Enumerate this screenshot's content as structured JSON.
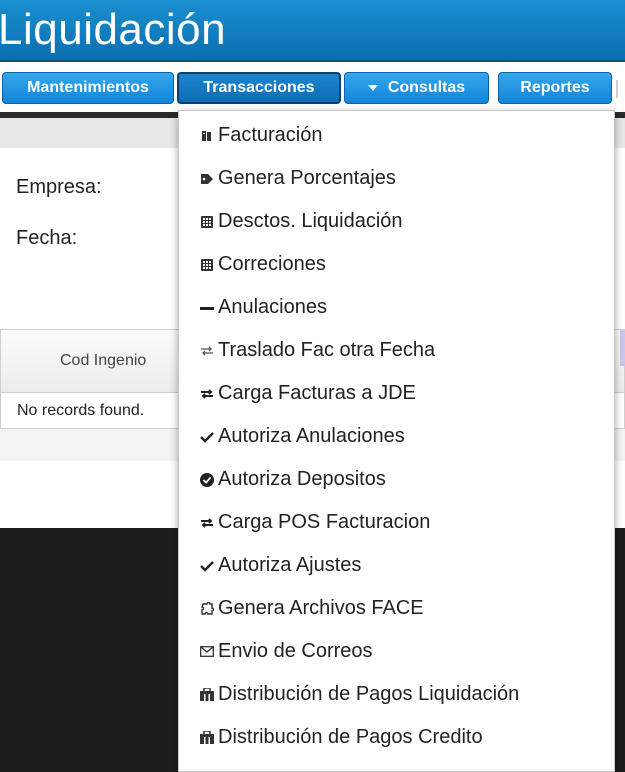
{
  "header": {
    "title": "Liquidación"
  },
  "nav": {
    "items": [
      {
        "label": "Mantenimientos"
      },
      {
        "label": "Transacciones"
      },
      {
        "label": "Consultas"
      },
      {
        "label": "Reportes"
      }
    ]
  },
  "form": {
    "empresa_label": "Empresa:",
    "fecha_label": "Fecha:"
  },
  "table": {
    "columns": [
      "Cod Ingenio"
    ],
    "empty_message": "No records found."
  },
  "menu": {
    "items": [
      {
        "label": "Facturación",
        "icon": "book-icon"
      },
      {
        "label": "Genera Porcentajes",
        "icon": "tag-icon"
      },
      {
        "label": "Desctos. Liquidación",
        "icon": "calculator-icon"
      },
      {
        "label": "Correciones",
        "icon": "calculator-icon"
      },
      {
        "label": "Anulaciones",
        "icon": "minus-icon"
      },
      {
        "label": "Traslado Fac otra Fecha",
        "icon": "transfer-icon"
      },
      {
        "label": "Carga Facturas a JDE",
        "icon": "transfer-icon"
      },
      {
        "label": "Autoriza Anulaciones",
        "icon": "check-icon"
      },
      {
        "label": "Autoriza Depositos",
        "icon": "check-circle-icon"
      },
      {
        "label": "Carga POS Facturacion",
        "icon": "transfer-icon"
      },
      {
        "label": "Autoriza Ajustes",
        "icon": "check-icon"
      },
      {
        "label": "Genera Archivos FACE",
        "icon": "puzzle-icon"
      },
      {
        "label": "Envio de Correos",
        "icon": "envelope-icon"
      },
      {
        "label": "Distribución de Pagos Liquidación",
        "icon": "briefcase-icon"
      },
      {
        "label": "Distribución de Pagos Credito",
        "icon": "briefcase-icon"
      }
    ]
  }
}
